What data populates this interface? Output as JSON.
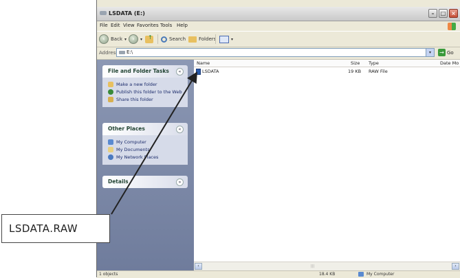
{
  "window": {
    "title": "LSDATA (E:)",
    "menu": [
      "File",
      "Edit",
      "View",
      "Favorites",
      "Tools",
      "Help"
    ],
    "toolbar": {
      "back_label": "Back",
      "search_label": "Search",
      "folders_label": "Folders"
    },
    "address": {
      "label": "Address",
      "value": "E:\\",
      "go_label": "Go"
    }
  },
  "sidebar": {
    "file_folder_tasks": {
      "title": "File and Folder Tasks",
      "items": [
        {
          "label": "Make a new folder",
          "icon": "folder-new-icon"
        },
        {
          "label": "Publish this folder to the Web",
          "icon": "globe-icon"
        },
        {
          "label": "Share this folder",
          "icon": "share-folder-icon"
        }
      ]
    },
    "other_places": {
      "title": "Other Places",
      "items": [
        {
          "label": "My Computer",
          "icon": "computer-icon"
        },
        {
          "label": "My Documents",
          "icon": "documents-icon"
        },
        {
          "label": "My Network Places",
          "icon": "network-icon"
        }
      ]
    },
    "details": {
      "title": "Details"
    }
  },
  "file_list": {
    "columns": [
      "Name",
      "Size",
      "Type",
      "Date Mo"
    ],
    "rows": [
      {
        "name": "LSDATA",
        "size": "19 KB",
        "type": "RAW File"
      }
    ]
  },
  "status_bar": {
    "objects": "1 objects",
    "size": "18.4 KB",
    "location": "My Computer"
  },
  "callout": {
    "label": "LSDATA.RAW"
  }
}
